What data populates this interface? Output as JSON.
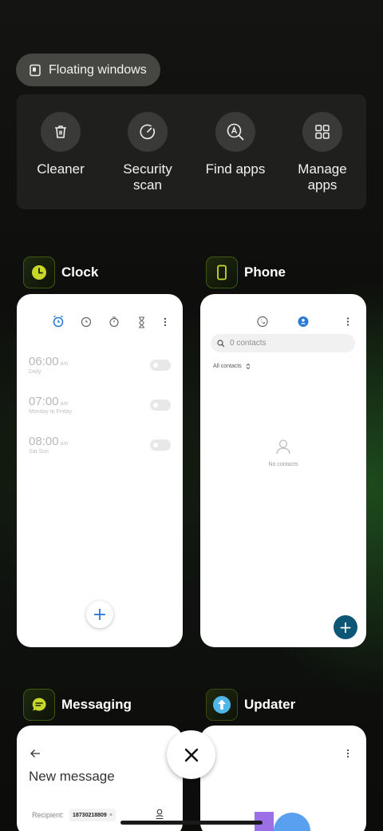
{
  "floating_windows": {
    "label": "Floating windows"
  },
  "tools": [
    {
      "label": "Cleaner",
      "icon": "trash-icon"
    },
    {
      "label": "Security\nscan",
      "icon": "security-scan-icon"
    },
    {
      "label": "Find apps",
      "icon": "find-apps-icon"
    },
    {
      "label": "Manage\napps",
      "icon": "grid-icon"
    }
  ],
  "apps": {
    "clock": {
      "name": "Clock",
      "alarms": [
        {
          "time": "06:00",
          "ampm": "am",
          "repeat": "Daily"
        },
        {
          "time": "07:00",
          "ampm": "am",
          "repeat": "Monday to Friday"
        },
        {
          "time": "08:00",
          "ampm": "am",
          "repeat": "Sat Sun"
        }
      ],
      "fab": "+"
    },
    "phone": {
      "name": "Phone",
      "search_placeholder": "0 contacts",
      "filter": "All contacts",
      "empty_text": "No contacts",
      "fab": "+"
    },
    "messaging": {
      "name": "Messaging",
      "title": "New message",
      "recipient_label": "Recipient:",
      "recipient_chip": "18730218809",
      "chip_remove": "×"
    },
    "updater": {
      "name": "Updater"
    }
  },
  "colors": {
    "accent_blue": "#2a7bd6",
    "fab_dark": "#0e5676",
    "app_icon_accent": "#c8d82a"
  }
}
